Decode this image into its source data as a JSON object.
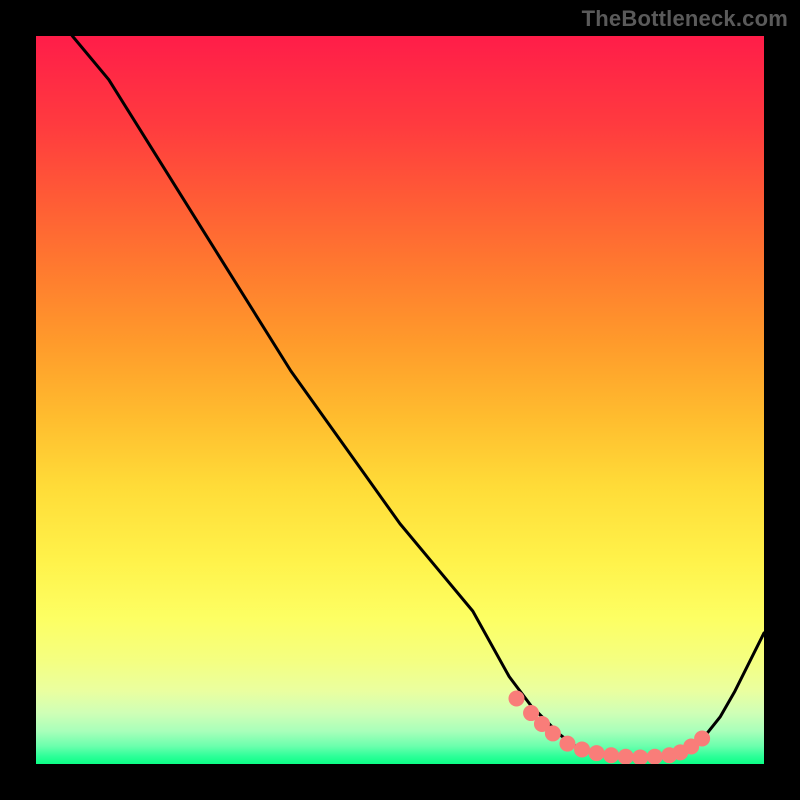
{
  "watermark": "TheBottleneck.com",
  "chart_data": {
    "type": "line",
    "title": "",
    "xlabel": "",
    "ylabel": "",
    "xlim": [
      0,
      100
    ],
    "ylim": [
      0,
      100
    ],
    "curve": {
      "x": [
        2,
        5,
        10,
        15,
        20,
        25,
        30,
        35,
        40,
        45,
        50,
        55,
        60,
        65,
        68,
        70,
        72,
        74,
        76,
        78,
        80,
        82,
        84,
        86,
        88,
        90,
        92,
        94,
        96,
        98,
        100
      ],
      "y": [
        104,
        100,
        94,
        86,
        78,
        70,
        62,
        54,
        47,
        40,
        33,
        27,
        21,
        12,
        8,
        6,
        4,
        2.5,
        1.8,
        1.3,
        1.0,
        0.9,
        0.9,
        1.0,
        1.5,
        2.5,
        4,
        6.5,
        10,
        14,
        18
      ]
    },
    "markers": {
      "x": [
        66,
        68,
        69.5,
        71,
        73,
        75,
        77,
        79,
        81,
        83,
        85,
        87,
        88.5,
        90,
        91.5
      ],
      "y": [
        9,
        7,
        5.5,
        4.2,
        2.8,
        2.0,
        1.5,
        1.2,
        1.0,
        0.9,
        1.0,
        1.2,
        1.6,
        2.4,
        3.5
      ]
    },
    "gradient_stops": [
      {
        "offset": 0.0,
        "color": "#ff1d49"
      },
      {
        "offset": 0.12,
        "color": "#ff3a3f"
      },
      {
        "offset": 0.22,
        "color": "#ff5a36"
      },
      {
        "offset": 0.32,
        "color": "#ff7a2f"
      },
      {
        "offset": 0.42,
        "color": "#ff9a2b"
      },
      {
        "offset": 0.52,
        "color": "#ffbb2e"
      },
      {
        "offset": 0.62,
        "color": "#ffdc38"
      },
      {
        "offset": 0.72,
        "color": "#fff24a"
      },
      {
        "offset": 0.8,
        "color": "#fdff63"
      },
      {
        "offset": 0.86,
        "color": "#f4ff82"
      },
      {
        "offset": 0.9,
        "color": "#eaffa0"
      },
      {
        "offset": 0.93,
        "color": "#cfffb6"
      },
      {
        "offset": 0.955,
        "color": "#a8ffba"
      },
      {
        "offset": 0.975,
        "color": "#6dffad"
      },
      {
        "offset": 0.99,
        "color": "#2bff97"
      },
      {
        "offset": 1.0,
        "color": "#0cff86"
      }
    ],
    "marker_color": "#f97d79",
    "line_color": "#000000"
  }
}
